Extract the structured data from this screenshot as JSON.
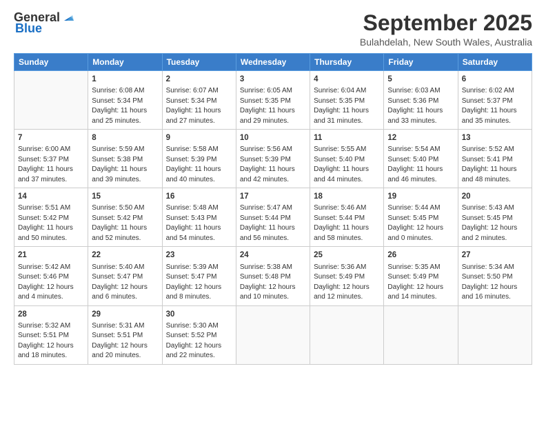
{
  "header": {
    "logo_general": "General",
    "logo_blue": "Blue",
    "month": "September 2025",
    "location": "Bulahdelah, New South Wales, Australia"
  },
  "weekdays": [
    "Sunday",
    "Monday",
    "Tuesday",
    "Wednesday",
    "Thursday",
    "Friday",
    "Saturday"
  ],
  "weeks": [
    [
      {
        "day": "",
        "info": ""
      },
      {
        "day": "1",
        "info": "Sunrise: 6:08 AM\nSunset: 5:34 PM\nDaylight: 11 hours\nand 25 minutes."
      },
      {
        "day": "2",
        "info": "Sunrise: 6:07 AM\nSunset: 5:34 PM\nDaylight: 11 hours\nand 27 minutes."
      },
      {
        "day": "3",
        "info": "Sunrise: 6:05 AM\nSunset: 5:35 PM\nDaylight: 11 hours\nand 29 minutes."
      },
      {
        "day": "4",
        "info": "Sunrise: 6:04 AM\nSunset: 5:35 PM\nDaylight: 11 hours\nand 31 minutes."
      },
      {
        "day": "5",
        "info": "Sunrise: 6:03 AM\nSunset: 5:36 PM\nDaylight: 11 hours\nand 33 minutes."
      },
      {
        "day": "6",
        "info": "Sunrise: 6:02 AM\nSunset: 5:37 PM\nDaylight: 11 hours\nand 35 minutes."
      }
    ],
    [
      {
        "day": "7",
        "info": "Sunrise: 6:00 AM\nSunset: 5:37 PM\nDaylight: 11 hours\nand 37 minutes."
      },
      {
        "day": "8",
        "info": "Sunrise: 5:59 AM\nSunset: 5:38 PM\nDaylight: 11 hours\nand 39 minutes."
      },
      {
        "day": "9",
        "info": "Sunrise: 5:58 AM\nSunset: 5:39 PM\nDaylight: 11 hours\nand 40 minutes."
      },
      {
        "day": "10",
        "info": "Sunrise: 5:56 AM\nSunset: 5:39 PM\nDaylight: 11 hours\nand 42 minutes."
      },
      {
        "day": "11",
        "info": "Sunrise: 5:55 AM\nSunset: 5:40 PM\nDaylight: 11 hours\nand 44 minutes."
      },
      {
        "day": "12",
        "info": "Sunrise: 5:54 AM\nSunset: 5:40 PM\nDaylight: 11 hours\nand 46 minutes."
      },
      {
        "day": "13",
        "info": "Sunrise: 5:52 AM\nSunset: 5:41 PM\nDaylight: 11 hours\nand 48 minutes."
      }
    ],
    [
      {
        "day": "14",
        "info": "Sunrise: 5:51 AM\nSunset: 5:42 PM\nDaylight: 11 hours\nand 50 minutes."
      },
      {
        "day": "15",
        "info": "Sunrise: 5:50 AM\nSunset: 5:42 PM\nDaylight: 11 hours\nand 52 minutes."
      },
      {
        "day": "16",
        "info": "Sunrise: 5:48 AM\nSunset: 5:43 PM\nDaylight: 11 hours\nand 54 minutes."
      },
      {
        "day": "17",
        "info": "Sunrise: 5:47 AM\nSunset: 5:44 PM\nDaylight: 11 hours\nand 56 minutes."
      },
      {
        "day": "18",
        "info": "Sunrise: 5:46 AM\nSunset: 5:44 PM\nDaylight: 11 hours\nand 58 minutes."
      },
      {
        "day": "19",
        "info": "Sunrise: 5:44 AM\nSunset: 5:45 PM\nDaylight: 12 hours\nand 0 minutes."
      },
      {
        "day": "20",
        "info": "Sunrise: 5:43 AM\nSunset: 5:45 PM\nDaylight: 12 hours\nand 2 minutes."
      }
    ],
    [
      {
        "day": "21",
        "info": "Sunrise: 5:42 AM\nSunset: 5:46 PM\nDaylight: 12 hours\nand 4 minutes."
      },
      {
        "day": "22",
        "info": "Sunrise: 5:40 AM\nSunset: 5:47 PM\nDaylight: 12 hours\nand 6 minutes."
      },
      {
        "day": "23",
        "info": "Sunrise: 5:39 AM\nSunset: 5:47 PM\nDaylight: 12 hours\nand 8 minutes."
      },
      {
        "day": "24",
        "info": "Sunrise: 5:38 AM\nSunset: 5:48 PM\nDaylight: 12 hours\nand 10 minutes."
      },
      {
        "day": "25",
        "info": "Sunrise: 5:36 AM\nSunset: 5:49 PM\nDaylight: 12 hours\nand 12 minutes."
      },
      {
        "day": "26",
        "info": "Sunrise: 5:35 AM\nSunset: 5:49 PM\nDaylight: 12 hours\nand 14 minutes."
      },
      {
        "day": "27",
        "info": "Sunrise: 5:34 AM\nSunset: 5:50 PM\nDaylight: 12 hours\nand 16 minutes."
      }
    ],
    [
      {
        "day": "28",
        "info": "Sunrise: 5:32 AM\nSunset: 5:51 PM\nDaylight: 12 hours\nand 18 minutes."
      },
      {
        "day": "29",
        "info": "Sunrise: 5:31 AM\nSunset: 5:51 PM\nDaylight: 12 hours\nand 20 minutes."
      },
      {
        "day": "30",
        "info": "Sunrise: 5:30 AM\nSunset: 5:52 PM\nDaylight: 12 hours\nand 22 minutes."
      },
      {
        "day": "",
        "info": ""
      },
      {
        "day": "",
        "info": ""
      },
      {
        "day": "",
        "info": ""
      },
      {
        "day": "",
        "info": ""
      }
    ]
  ]
}
